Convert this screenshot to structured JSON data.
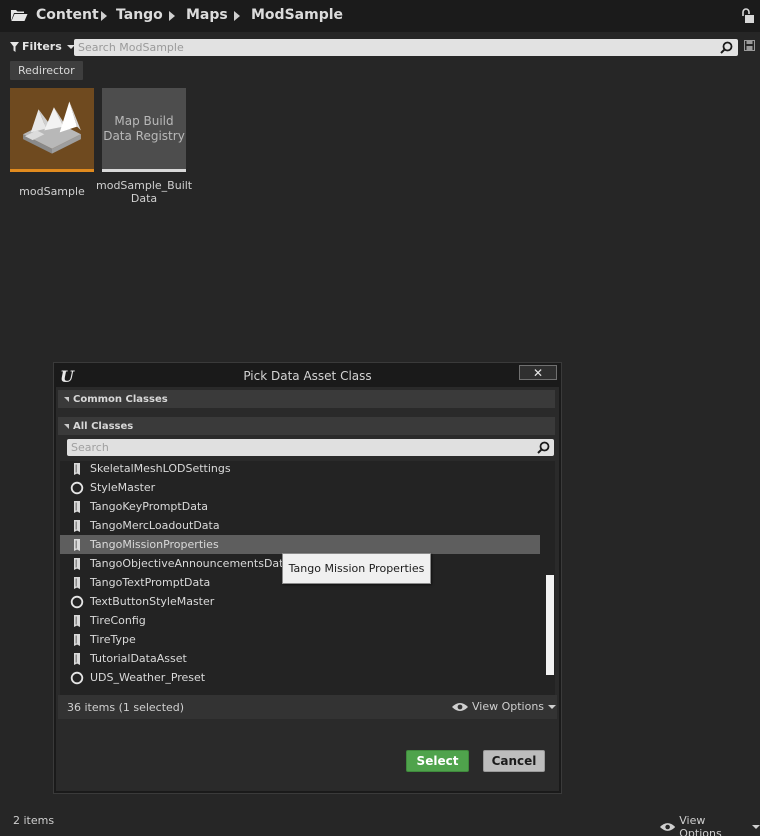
{
  "breadcrumb": {
    "items": [
      "Content",
      "Tango",
      "Maps",
      "ModSample"
    ]
  },
  "toolbar": {
    "filters_label": "Filters",
    "search_placeholder": "Search ModSample"
  },
  "filter_chips": [
    "Redirector"
  ],
  "assets": [
    {
      "name": "modSample",
      "thumb_text": ""
    },
    {
      "name_line1": "modSample_Built",
      "name_line2": "Data",
      "thumb_line1": "Map Build",
      "thumb_line2": "Data Registry"
    }
  ],
  "status": {
    "items_count": "2 items",
    "view_options": "View Options"
  },
  "dialog": {
    "title": "Pick Data Asset Class",
    "close_symbol": "✕",
    "common_classes": "Common Classes",
    "all_classes": "All Classes",
    "search_placeholder": "Search",
    "classes": [
      {
        "label": "SkeletalMeshLODSettings",
        "icon": "data-asset-icon"
      },
      {
        "label": "StyleMaster",
        "icon": "circle-class-icon"
      },
      {
        "label": "TangoKeyPromptData",
        "icon": "data-asset-icon"
      },
      {
        "label": "TangoMercLoadoutData",
        "icon": "data-asset-icon"
      },
      {
        "label": "TangoMissionProperties",
        "icon": "data-asset-icon",
        "selected": true
      },
      {
        "label": "TangoObjectiveAnnouncementsData",
        "icon": "data-asset-icon"
      },
      {
        "label": "TangoTextPromptData",
        "icon": "data-asset-icon"
      },
      {
        "label": "TextButtonStyleMaster",
        "icon": "circle-class-icon"
      },
      {
        "label": "TireConfig",
        "icon": "data-asset-icon"
      },
      {
        "label": "TireType",
        "icon": "data-asset-icon"
      },
      {
        "label": "TutorialDataAsset",
        "icon": "data-asset-icon"
      },
      {
        "label": "UDS_Weather_Preset",
        "icon": "circle-class-icon"
      }
    ],
    "tooltip": "Tango Mission Properties",
    "items_count": "36 items (1 selected)",
    "view_options": "View Options",
    "select_label": "Select",
    "cancel_label": "Cancel"
  },
  "colors": {
    "select_button": "#4fa34c",
    "tile_selected_bar": "#e08a1e"
  }
}
